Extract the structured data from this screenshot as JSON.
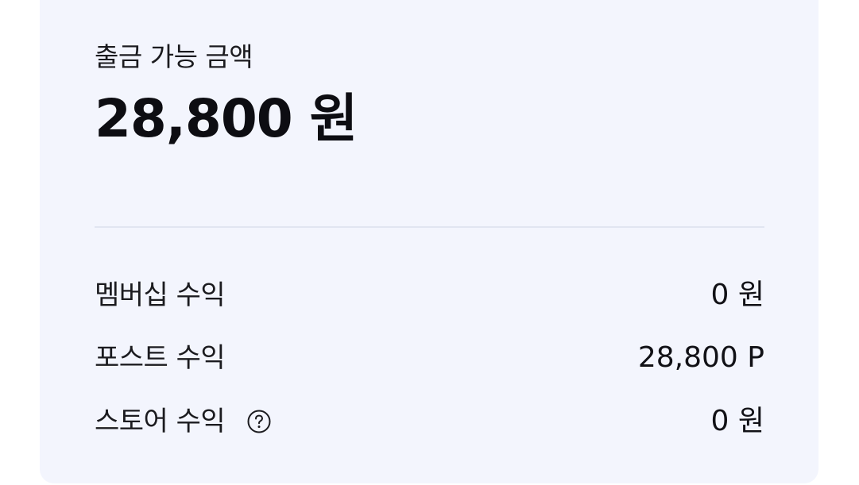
{
  "withdrawable": {
    "label": "출금 가능 금액",
    "amount": "28,800 원"
  },
  "earnings": [
    {
      "label": "멤버십 수익",
      "value": "0 원"
    },
    {
      "label": "포스트 수익",
      "value": "28,800 P"
    },
    {
      "label": "스토어 수익",
      "value": "0 원",
      "icon": "help-circle-icon"
    }
  ]
}
